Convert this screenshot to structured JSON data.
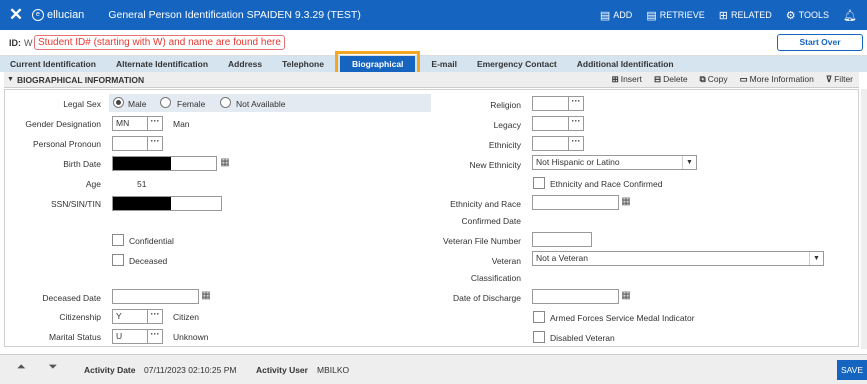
{
  "topbar": {
    "close": "✕",
    "brand": "ellucian",
    "title": "General Person Identification SPAIDEN 9.3.29 (TEST)",
    "add": "ADD",
    "retrieve": "RETRIEVE",
    "related": "RELATED",
    "tools": "TOOLS"
  },
  "idbar": {
    "label": "ID:",
    "value": "W",
    "note": "Student ID# (starting with W) and name are found here",
    "start_over": "Start Over"
  },
  "tabs": [
    "Current Identification",
    "Alternate Identification",
    "Address",
    "Telephone",
    "Biographical",
    "E-mail",
    "Emergency Contact",
    "Additional Identification"
  ],
  "section": {
    "title": "BIOGRAPHICAL INFORMATION",
    "insert": "Insert",
    "delete": "Delete",
    "copy": "Copy",
    "more": "More Information",
    "filter": "Filter"
  },
  "left": {
    "legal_sex": "Legal Sex",
    "male": "Male",
    "female": "Female",
    "not_available": "Not Available",
    "gender_designation": "Gender Designation",
    "gender_code": "MN",
    "gender_desc": "Man",
    "personal_pronoun": "Personal Pronoun",
    "birth_date": "Birth Date",
    "age": "Age",
    "age_value": "51",
    "ssn": "SSN/SIN/TIN",
    "confidential": "Confidential",
    "deceased": "Deceased",
    "deceased_date": "Deceased Date",
    "citizenship": "Citizenship",
    "citizenship_code": "Y",
    "citizenship_desc": "Citizen",
    "marital_status": "Marital Status",
    "marital_code": "U",
    "marital_desc": "Unknown"
  },
  "right": {
    "religion": "Religion",
    "legacy": "Legacy",
    "ethnicity": "Ethnicity",
    "new_ethnicity": "New Ethnicity",
    "new_ethnicity_value": "Not Hispanic or Latino",
    "eth_race_confirmed": "Ethnicity and Race Confirmed",
    "eth_race_line1": "Ethnicity and Race",
    "eth_race_line2": "Confirmed Date",
    "veteran_file": "Veteran File Number",
    "veteran_line1": "Veteran",
    "veteran_line2": "Classification",
    "veteran_value": "Not a Veteran",
    "discharge": "Date of Discharge",
    "armed_forces": "Armed Forces Service Medal Indicator",
    "disabled_veteran": "Disabled Veteran"
  },
  "bottom": {
    "activity_date_label": "Activity Date",
    "activity_date": "07/11/2023 02:10:25 PM",
    "activity_user_label": "Activity User",
    "activity_user": "MBILKO",
    "save": "SAVE"
  }
}
